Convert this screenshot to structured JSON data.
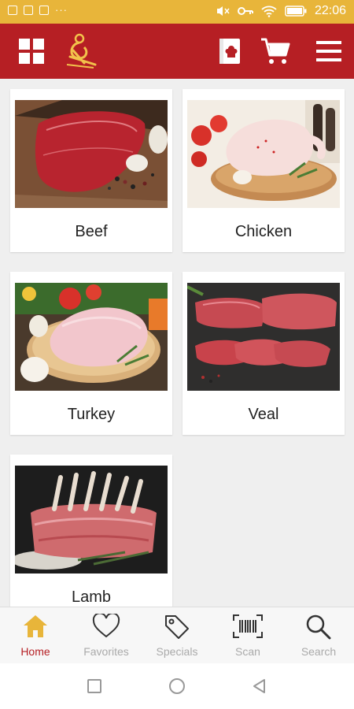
{
  "status_bar": {
    "time": "22:06",
    "overflow": "···"
  },
  "toolbar": {
    "menu_grid_icon": "grid-icon",
    "logo": "chef-logo",
    "recipes_icon": "recipe-book-icon",
    "cart_icon": "cart-icon",
    "menu_icon": "hamburger-menu-icon"
  },
  "categories": [
    {
      "name": "Beef"
    },
    {
      "name": "Chicken"
    },
    {
      "name": "Turkey"
    },
    {
      "name": "Veal"
    },
    {
      "name": "Lamb"
    }
  ],
  "bottom_nav": {
    "items": [
      {
        "label": "Home",
        "icon": "home-icon",
        "active": true
      },
      {
        "label": "Favorites",
        "icon": "heart-icon"
      },
      {
        "label": "Specials",
        "icon": "tag-icon"
      },
      {
        "label": "Scan",
        "icon": "barcode-scan-icon"
      },
      {
        "label": "Search",
        "icon": "search-icon"
      }
    ]
  },
  "colors": {
    "brand_red": "#b61f24",
    "status_gold": "#e8b53a",
    "logo_gold": "#f2c24b"
  }
}
